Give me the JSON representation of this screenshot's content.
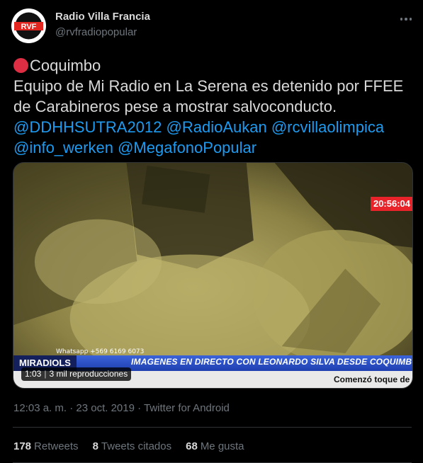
{
  "author": {
    "name": "Radio Villa Francia",
    "handle": "@rvfradiopopular",
    "avatar_text": "RVF"
  },
  "tweet": {
    "line1": "Coquimbo",
    "line2": "Equipo de Mi Radio en La Serena es detenido por FFEE",
    "line3": "de Carabineros pese a mostrar salvoconducto.",
    "mentions": [
      "@DDHHSUTRA2012",
      "@RadioAukan",
      "@rcvillaolimpica",
      "@info_werken",
      "@MegafonoPopular"
    ]
  },
  "media": {
    "clock": "20:56:04",
    "phone": "Whatsapp +569 6169 6073",
    "ticker_logo": "MIRADIOLS",
    "ticker_text": "IMAGENES EN DIRECTO CON LEONARDO SILVA DESDE COQUIMBO",
    "sub_text": "Comenzó toque de",
    "duration": "1:03",
    "views": "3 mil reproducciones"
  },
  "meta": {
    "text": "12:03 a. m. · 23 oct. 2019 · Twitter for Android"
  },
  "stats": {
    "retweets_count": "178",
    "retweets_label": "Retweets",
    "quotes_count": "8",
    "quotes_label": "Tweets citados",
    "likes_count": "68",
    "likes_label": "Me gusta"
  },
  "colors": {
    "background": "#000000",
    "link": "#1d9bf0",
    "muted": "#6e767d",
    "red_emoji": "#dd2e44"
  },
  "icons": [
    "more-icon",
    "red-circle-icon"
  ]
}
